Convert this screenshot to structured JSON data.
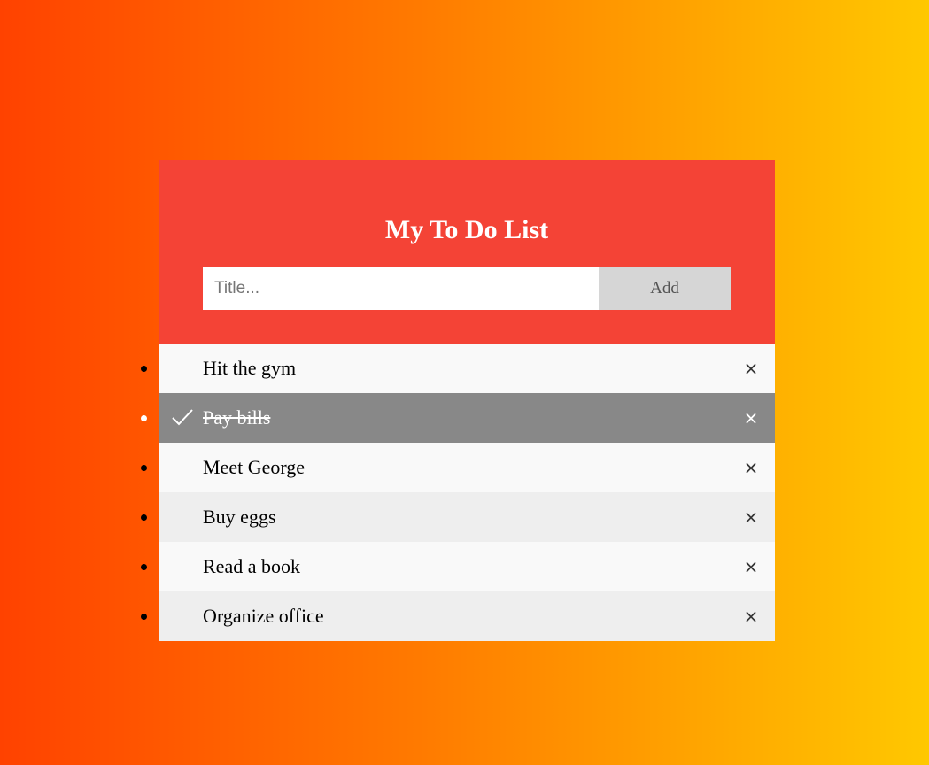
{
  "header": {
    "title": "My To Do List",
    "input_placeholder": "Title...",
    "input_value": "",
    "add_label": "Add"
  },
  "close_glyph": "×",
  "todos": [
    {
      "label": "Hit the gym",
      "checked": false
    },
    {
      "label": "Pay bills",
      "checked": true
    },
    {
      "label": "Meet George",
      "checked": false
    },
    {
      "label": "Buy eggs",
      "checked": false
    },
    {
      "label": "Read a book",
      "checked": false
    },
    {
      "label": "Organize office",
      "checked": false
    }
  ],
  "colors": {
    "header_bg": "#f44336",
    "checked_bg": "#888888",
    "odd_row_bg": "#f9f9f9",
    "even_row_bg": "#eeeeee",
    "add_button_bg": "#d6d6d6",
    "gradient_start": "#ff4200",
    "gradient_end": "#ffc800"
  }
}
